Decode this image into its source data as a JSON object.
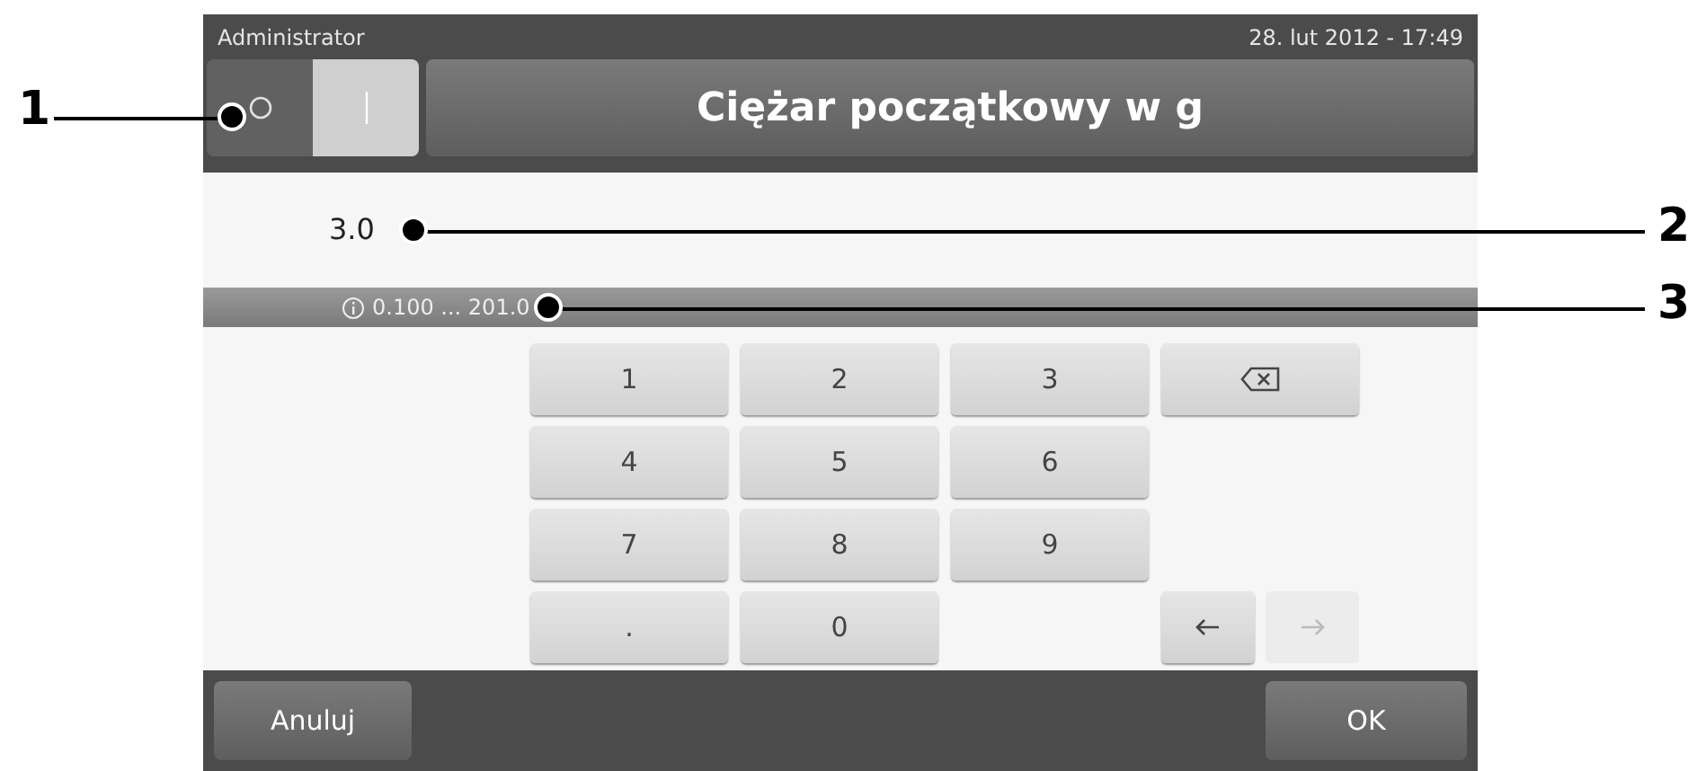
{
  "header": {
    "user": "Administrator",
    "datetime": "28. lut 2012 - 17:49"
  },
  "toggle": [
    {
      "kind": "off",
      "selected": false
    },
    {
      "kind": "on",
      "selected": true
    }
  ],
  "title": "Ciężar początkowy w g",
  "value": "3.0",
  "range": "0.100 ... 201.0",
  "keypad": [
    [
      {
        "kind": "key",
        "label": "1"
      },
      {
        "kind": "key",
        "label": "2"
      },
      {
        "kind": "key",
        "label": "3"
      },
      {
        "kind": "backspace",
        "disabled": false
      }
    ],
    [
      {
        "kind": "key",
        "label": "4"
      },
      {
        "kind": "key",
        "label": "5"
      },
      {
        "kind": "key",
        "label": "6"
      },
      {
        "kind": "empty"
      }
    ],
    [
      {
        "kind": "key",
        "label": "7"
      },
      {
        "kind": "key",
        "label": "8"
      },
      {
        "kind": "key",
        "label": "9"
      },
      {
        "kind": "empty"
      }
    ],
    [
      {
        "kind": "key",
        "label": "."
      },
      {
        "kind": "key",
        "label": "0"
      },
      {
        "kind": "empty"
      },
      {
        "kind": "arrows",
        "left_disabled": false,
        "right_disabled": true
      }
    ]
  ],
  "buttons": [
    "Anuluj",
    "OK"
  ],
  "callouts": [
    {
      "label": "1"
    },
    {
      "label": "2"
    },
    {
      "label": "3"
    }
  ]
}
